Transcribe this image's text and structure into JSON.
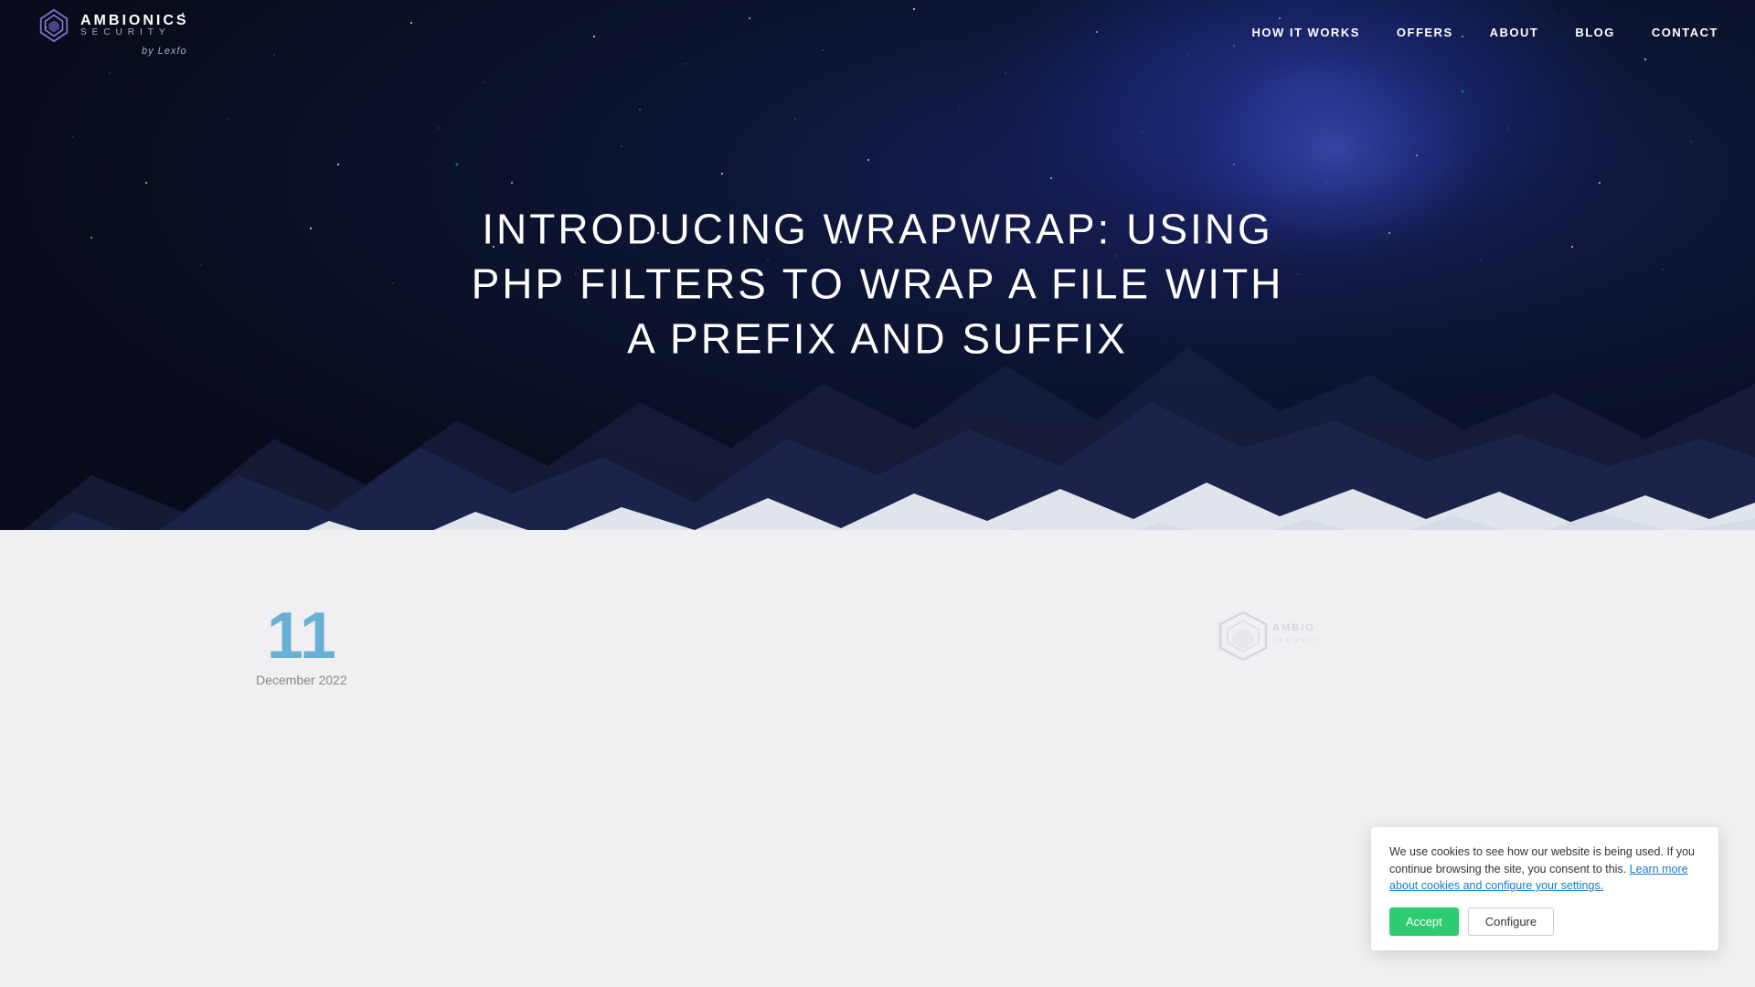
{
  "site": {
    "name": "AMBIONICS",
    "subtitle": "SECURITY",
    "by": "by Lexfo"
  },
  "nav": {
    "items": [
      {
        "label": "HOW IT WORKS",
        "id": "how-it-works"
      },
      {
        "label": "OFFERS",
        "id": "offers"
      },
      {
        "label": "ABOUT",
        "id": "about"
      },
      {
        "label": "BLOG",
        "id": "blog"
      },
      {
        "label": "CONTACT",
        "id": "contact"
      }
    ]
  },
  "hero": {
    "title": "INTRODUCING WRAPWRAP: USING PHP FILTERS TO WRAP A FILE WITH A PREFIX AND SUFFIX"
  },
  "article": {
    "day": "11",
    "month": "December 2022"
  },
  "cookie": {
    "message": "We use cookies to see how our website is being used. If you continue browsing the site, you consent to this.",
    "link_text": "Learn more about cookies and configure your settings.",
    "accept_label": "Accept",
    "configure_label": "Configure"
  }
}
